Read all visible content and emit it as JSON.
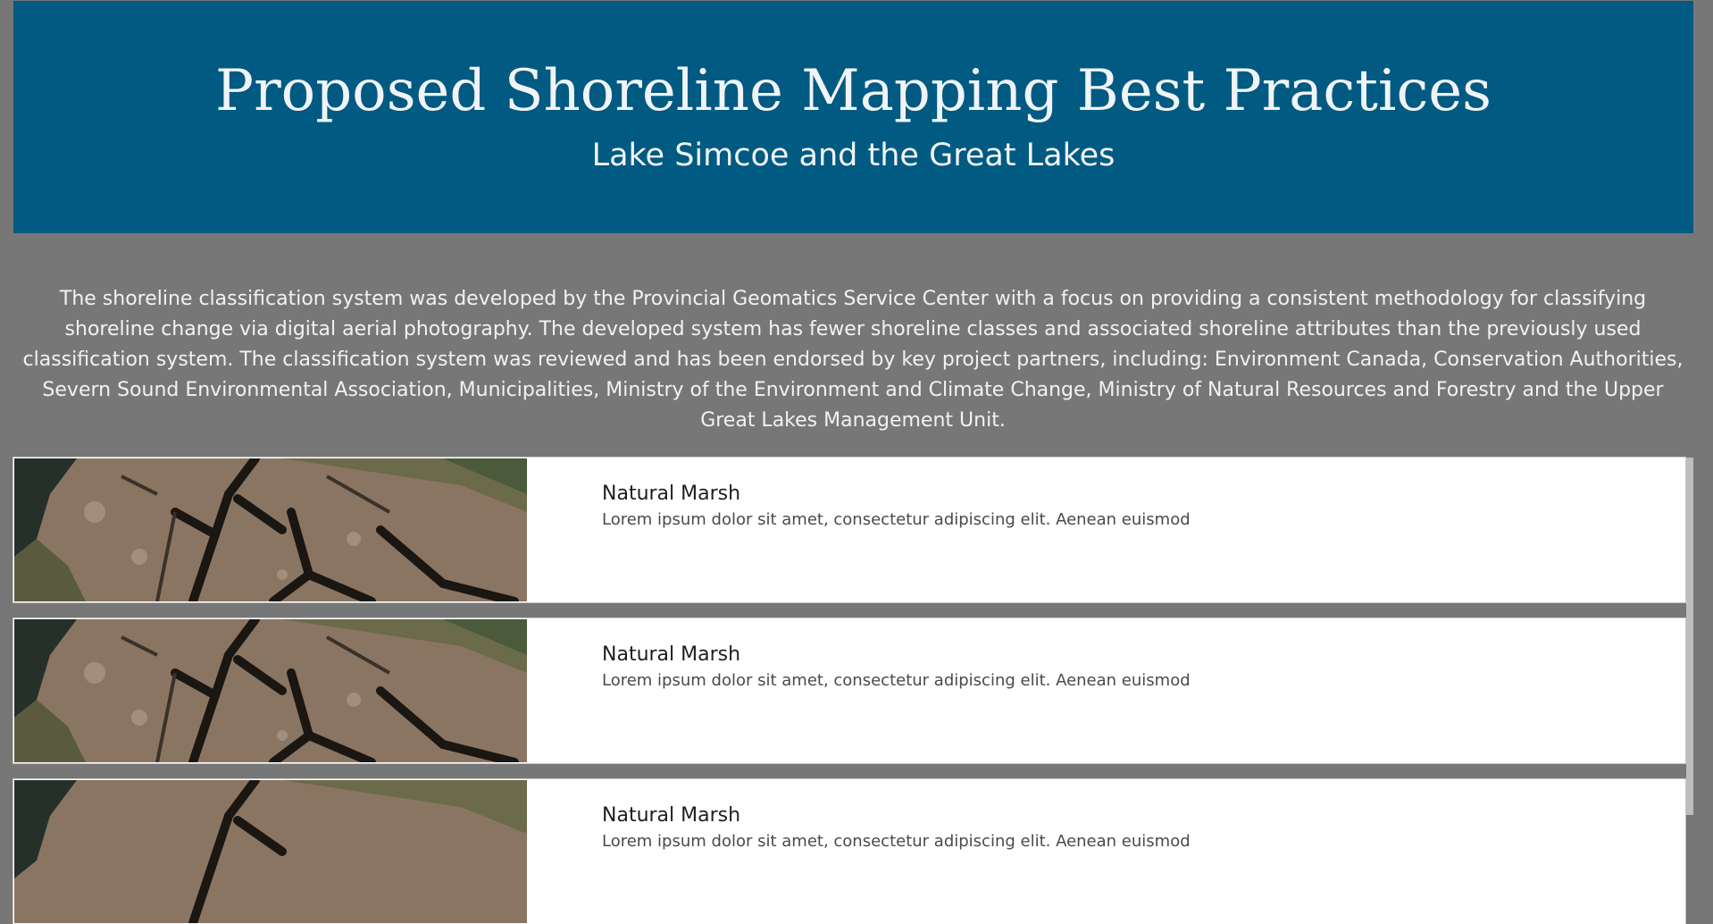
{
  "header": {
    "title": "Proposed Shoreline Mapping Best Practices",
    "subtitle": "Lake Simcoe and the Great Lakes",
    "background_color": "#005a82"
  },
  "intro": {
    "text": "The shoreline classification system was developed by the Provincial Geomatics Service Center with a focus on providing a consistent methodology for classifying shoreline change via digital aerial photography. The developed system has fewer shoreline classes and associated shoreline attributes than the previously used classification system. The classification system was reviewed and has been endorsed by key project partners, including: Environment Canada, Conservation Authorities, Severn Sound Environmental Association, Municipalities, Ministry of the Environment and Climate Change, Ministry of Natural Resources and Forestry and the Upper Great Lakes Management Unit."
  },
  "cards": [
    {
      "title": "Natural Marsh",
      "description": "Lorem ipsum dolor sit amet, consectetur adipiscing elit. Aenean euismod",
      "thumbnail_icon": "aerial-marsh-photo"
    },
    {
      "title": "Natural Marsh",
      "description": "Lorem ipsum dolor sit amet, consectetur adipiscing elit. Aenean euismod",
      "thumbnail_icon": "aerial-marsh-photo"
    },
    {
      "title": "Natural Marsh",
      "description": "Lorem ipsum dolor sit amet, consectetur adipiscing elit. Aenean euismod",
      "thumbnail_icon": "aerial-marsh-photo"
    }
  ],
  "colors": {
    "page_background": "#777777",
    "card_background": "#ffffff"
  }
}
